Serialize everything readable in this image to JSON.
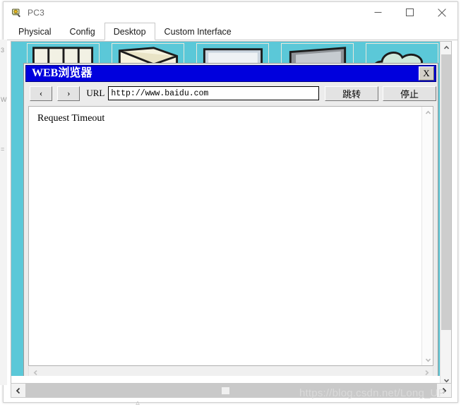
{
  "window": {
    "title": "PC3",
    "icon": "pc-device-icon",
    "controls": {
      "minimize": "minimize-icon",
      "maximize": "maximize-icon",
      "close": "close-icon"
    }
  },
  "tabs": [
    {
      "label": "Physical",
      "active": false
    },
    {
      "label": "Config",
      "active": false
    },
    {
      "label": "Desktop",
      "active": true
    },
    {
      "label": "Custom Interface",
      "active": false
    }
  ],
  "desktop": {
    "background_color": "#5bc8d8",
    "icons": [
      {
        "name": "desktop-icon-1",
        "art": "windows-tiles"
      },
      {
        "name": "desktop-icon-2",
        "art": "open-folder"
      },
      {
        "name": "desktop-icon-3",
        "art": "monitor-light"
      },
      {
        "name": "desktop-icon-4",
        "art": "monitor-dark"
      },
      {
        "name": "desktop-icon-5",
        "art": "cloud"
      }
    ]
  },
  "browser": {
    "title": "WEB浏览器",
    "close_label": "X",
    "back_label": "‹",
    "forward_label": "›",
    "url_label": "URL",
    "url_value": "http://www.baidu.com",
    "url_placeholder": "http://",
    "go_label": "跳转",
    "stop_label": "停止",
    "page_content": "Request Timeout",
    "title_bar_color": "#0000dd"
  },
  "scrollbars": {
    "up_arrow": "chevron-up-icon",
    "down_arrow": "chevron-down-icon",
    "left_arrow": "chevron-left-icon",
    "right_arrow": "chevron-right-icon"
  },
  "watermark": "https://blog.csdn.net/Long_UP"
}
